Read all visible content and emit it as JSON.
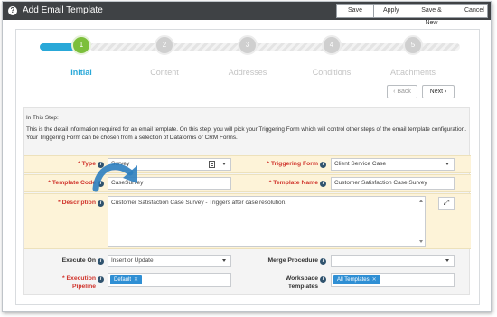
{
  "window": {
    "title": "Add Email Template",
    "help_icon": "question-circle-icon"
  },
  "toolbar": {
    "save_label": "Save",
    "apply_label": "Apply",
    "save_new_label": "Save & New",
    "cancel_label": "Cancel"
  },
  "steps": [
    {
      "number": "1",
      "label": "Initial",
      "state": "active"
    },
    {
      "number": "2",
      "label": "Content",
      "state": "inactive"
    },
    {
      "number": "3",
      "label": "Addresses",
      "state": "inactive"
    },
    {
      "number": "4",
      "label": "Conditions",
      "state": "inactive"
    },
    {
      "number": "5",
      "label": "Attachments",
      "state": "inactive"
    }
  ],
  "nav": {
    "back_label": "Back",
    "next_label": "Next"
  },
  "info": {
    "heading": "In This Step:",
    "line1": "This is the detail information required for an email template. On this step, you will pick your Triggering Form which will control other steps of the email template configuration.",
    "line2": "Your Triggering Form can be chosen from a selection of Dataforms or CRM Forms."
  },
  "form": {
    "type": {
      "label": "* Type",
      "value": "Survey"
    },
    "triggering_form": {
      "label": "* Triggering Form",
      "value": "Client Service Case"
    },
    "template_code": {
      "label": "* Template Code",
      "value": "CaseSurvey"
    },
    "template_name": {
      "label": "* Template Name",
      "value": "Customer Satisfaction Case Survey"
    },
    "description": {
      "label": "* Description",
      "value": "Customer Satisfaction Case Survey - Triggers after case resolution."
    },
    "execute_on": {
      "label": "Execute On",
      "value": "Insert or Update"
    },
    "merge_procedure": {
      "label": "Merge Procedure",
      "value": ""
    },
    "execution_pipeline": {
      "label_line1": "* Execution",
      "label_line2": "Pipeline",
      "tag": "Default"
    },
    "workspace_templates": {
      "label_line1": "Workspace",
      "label_line2": "Templates",
      "tag": "All Templates"
    }
  },
  "colors": {
    "accent": "#29a8d8",
    "step_active": "#7cbf3b",
    "required": "#d0342c",
    "highlight": "#fdf3d8",
    "tag": "#2f8fd4",
    "titlebar": "#3f4245"
  }
}
